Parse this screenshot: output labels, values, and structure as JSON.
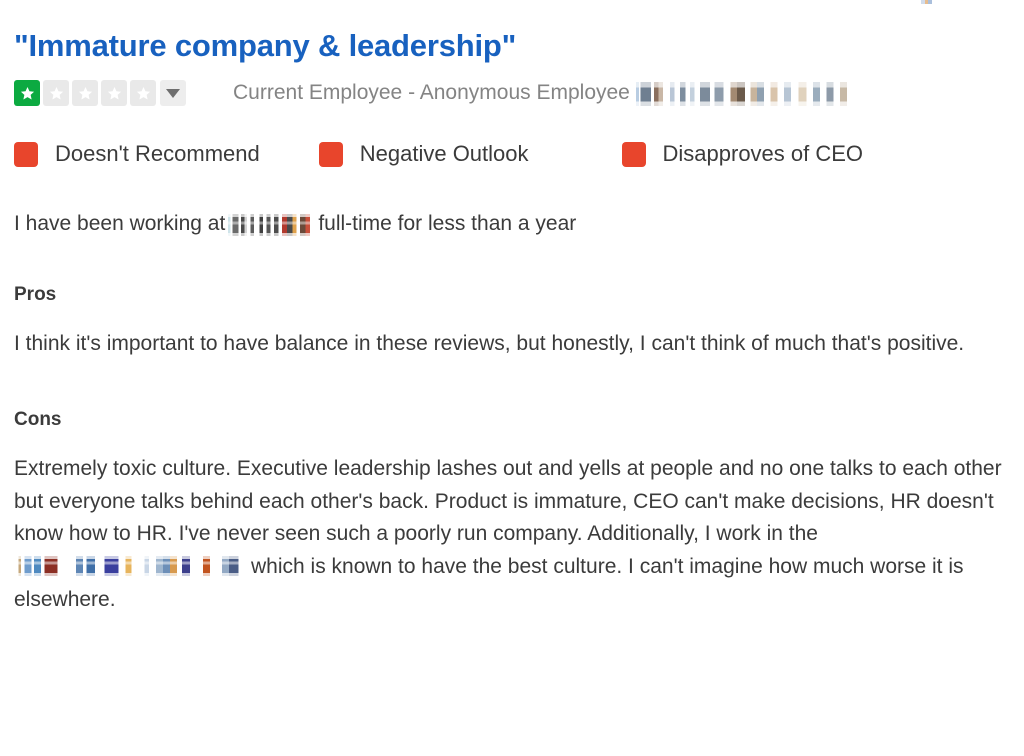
{
  "review": {
    "title": "\"Immature company & leadership\"",
    "rating": {
      "value": 1,
      "max": 5,
      "filled_color": "#0caa41",
      "empty_color": "#e9e9e9",
      "caret_icon": "chevron-down-icon"
    },
    "employee_status": "Current Employee - Anonymous Employee",
    "company_redacted": "[redacted]",
    "badges": [
      {
        "label": "Doesn't Recommend",
        "color": "#e8452c",
        "sentiment": "negative"
      },
      {
        "label": "Negative Outlook",
        "color": "#e8452c",
        "sentiment": "negative"
      },
      {
        "label": "Disapproves of CEO",
        "color": "#e8452c",
        "sentiment": "negative"
      }
    ],
    "employment": {
      "prefix": "I have been working at",
      "company_redacted": "[redacted]",
      "suffix": "full-time for less than a year"
    },
    "pros": {
      "heading": "Pros",
      "text": "I think it's important to have balance in these reviews, but honestly, I can't think of much that's positive."
    },
    "cons": {
      "heading": "Cons",
      "text_before": "Extremely toxic culture. Executive leadership lashes out and yells at people and no one talks to each other but everyone talks behind each other's back. Product is immature, CEO can't make decisions, HR doesn't know how to HR. I've never seen such a poorly run company. Additionally, I work in the",
      "department_redacted": "[redacted]",
      "text_after": "which is known to have the best culture. I can't imagine how much worse it is elsewhere."
    }
  },
  "colors": {
    "title_blue": "#1861bf",
    "body_text": "#3b3b3b",
    "muted_text": "#848484",
    "negative_red": "#e8452c",
    "star_green": "#0caa41"
  }
}
